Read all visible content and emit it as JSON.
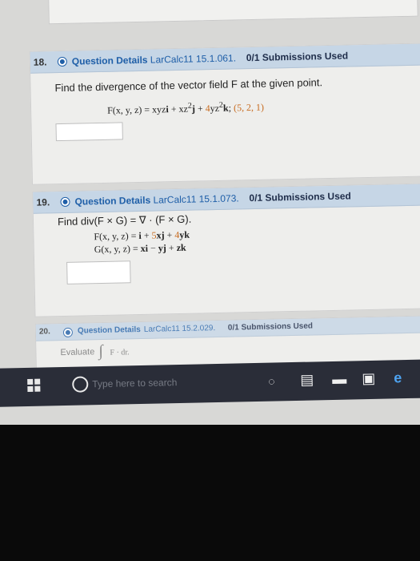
{
  "questions": [
    {
      "number": "18.",
      "details_label": "Question Details",
      "source": "LarCalc11 15.1.061.",
      "submissions": "0/1 Submissions Used",
      "prompt": "Find the divergence of the vector field F at the given point.",
      "formula": {
        "lhs": "F(x, y, z) = xyz",
        "i": "i",
        "plus1": " + xz",
        "sup2a": "2",
        "j": "j",
        "plus2": " + ",
        "coef": "4",
        "yz": "yz",
        "sup2b": "2",
        "k": "k",
        "semi": ";",
        "point": " (5, 2, 1)"
      }
    },
    {
      "number": "19.",
      "details_label": "Question Details",
      "source": "LarCalc11 15.1.073.",
      "submissions": "0/1 Submissions Used",
      "prompt": "Find div(F × G) = ∇ · (F × G).",
      "line1": {
        "lhs": "F(x, y, z) = ",
        "i": "i",
        "p1": " + ",
        "c1": "5",
        "xj": "xj",
        "p2": " + ",
        "c2": "4",
        "yk": "yk"
      },
      "line2": {
        "lhs": "G(x, y, z) = ",
        "xi": "xi",
        "m": " − ",
        "yj": "yj",
        "p": " + ",
        "zk": "zk"
      }
    },
    {
      "number": "20.",
      "details_label": "Question Details",
      "source": "LarCalc11 15.2.029.",
      "submissions": "0/1 Submissions Used",
      "prompt": "Evaluate",
      "integral": "∫",
      "integrand": "F · dr."
    }
  ],
  "taskbar": {
    "search_placeholder": "Type here to search"
  }
}
